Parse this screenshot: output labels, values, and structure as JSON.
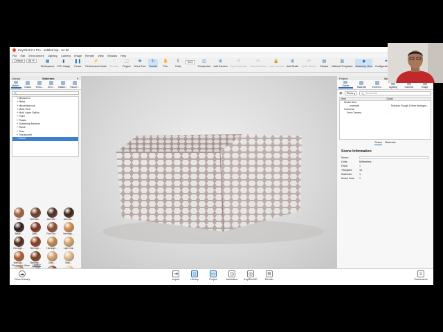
{
  "window": {
    "title": "KeyShot 8.1 Pro  -  untitled.bip  -  64 bit"
  },
  "menu": [
    "File",
    "Edit",
    "Environment",
    "Lighting",
    "Camera",
    "Image",
    "Render",
    "View",
    "Window",
    "Help"
  ],
  "toolbar": {
    "workspace_value": "Default",
    "cpu_value": "88 %",
    "fov_value": "90.0",
    "items": [
      {
        "label": "Workspaces",
        "icon": "workspaces-icon",
        "dim": false
      },
      {
        "label": "CPU Usage",
        "icon": "cpu-icon",
        "dim": false
      },
      {
        "label": "Pause",
        "icon": "pause-icon",
        "dim": false
      },
      {
        "label": "Performance Mode",
        "icon": "performance-icon",
        "dim": false
      },
      {
        "label": "Denoise",
        "icon": "denoise-icon",
        "dim": true
      },
      {
        "label": "Region",
        "icon": "region-icon",
        "dim": false
      },
      {
        "label": "Move Tool",
        "icon": "move-tool-icon",
        "dim": false
      },
      {
        "label": "Tumble",
        "icon": "tumble-icon",
        "dim": false,
        "active": true
      },
      {
        "label": "Pan",
        "icon": "pan-icon",
        "dim": false
      },
      {
        "label": "Dolly",
        "icon": "dolly-icon",
        "dim": false
      },
      {
        "label": "Perspective",
        "icon": "perspective-icon",
        "dim": false
      },
      {
        "label": "Add Camera",
        "icon": "add-camera-icon",
        "dim": false
      },
      {
        "label": "Cycle Cameras",
        "icon": "cycle-cameras-icon",
        "dim": true
      },
      {
        "label": "Reset Camera",
        "icon": "reset-camera-icon",
        "dim": true
      },
      {
        "label": "Lock Camera",
        "icon": "lock-camera-icon",
        "dim": true
      },
      {
        "label": "Add Studio",
        "icon": "add-studio-icon",
        "dim": false
      },
      {
        "label": "Cycle Studios",
        "icon": "cycle-studios-icon",
        "dim": true
      },
      {
        "label": "Studios",
        "icon": "studios-icon",
        "dim": false
      },
      {
        "label": "Material Templates",
        "icon": "material-templates-icon",
        "dim": false
      },
      {
        "label": "Geometry View",
        "icon": "geometry-view-icon",
        "dim": false,
        "active": true
      },
      {
        "label": "Configurator Wizard",
        "icon": "configurator-icon",
        "dim": false
      }
    ]
  },
  "library": {
    "title": "Library",
    "panel_title": "Materials",
    "tabs": [
      "Materi...",
      "Colors",
      "Textu...",
      "Envi...",
      "Backp...",
      "Favori..."
    ],
    "search_placeholder": "",
    "tree": [
      "Measured",
      "Metal",
      "Miscellaneous",
      "Mold-Tech",
      "Multi Layer Optics",
      "Paint",
      "Plastic",
      "Scattering Medium",
      "Stone",
      "Toon",
      "Translucent",
      "Wood"
    ],
    "selected": "Wood",
    "swatches": [
      {
        "label": "Ash",
        "color": "#a0603a"
      },
      {
        "label": "Ash Wo...",
        "color": "#6a3a22"
      },
      {
        "label": "Ash Wo...",
        "color": "#4a2a1e"
      },
      {
        "label": "Ash Wo...",
        "color": "#3a1f14"
      },
      {
        "label": "Black...",
        "color": "#2a1a14"
      },
      {
        "label": "Dark...",
        "color": "#7a2f1c"
      },
      {
        "label": "Fine Gra...",
        "color": "#8a4a2a"
      },
      {
        "label": "Herringb...",
        "color": "#d08a4a"
      },
      {
        "label": "Herringb...",
        "color": "#4a2616"
      },
      {
        "label": "Herringb...",
        "color": "#8a3a1c"
      },
      {
        "label": "Herringb...",
        "color": "#c0844a"
      },
      {
        "label": "Light Oak",
        "color": "#d6a26a"
      },
      {
        "label": "Mahoga...",
        "color": "#b05a2a"
      },
      {
        "label": "Mahoga...",
        "color": "#7a3a1c"
      },
      {
        "label": "Map...",
        "color": "#d4a070"
      },
      {
        "label": "Map...",
        "color": "#e0b890"
      },
      {
        "label": "Oak Wo...",
        "color": "#c88a50"
      },
      {
        "label": "Oak Wo...",
        "color": "#caa070"
      },
      {
        "label": "Oak Wo...",
        "color": "#8a4a24"
      },
      {
        "label": "Pine...",
        "color": "#e8c8a0"
      },
      {
        "label": "Pine...",
        "color": "#e6d2b8"
      },
      {
        "label": "Walnut",
        "color": "#6a2a1a"
      },
      {
        "label": "Wd...",
        "color": "#3a2418"
      }
    ],
    "bottom_tabs": [
      "Geometry View",
      "Library"
    ]
  },
  "project": {
    "title": "Project",
    "panel_title": "Scene",
    "tabs": [
      "Scene",
      "Material",
      "Environ...",
      "Lighting",
      "Camera",
      "Image"
    ],
    "show_label": "Show",
    "search_placeholder": "Search All",
    "columns": [
      "Item",
      "Detail"
    ],
    "rows": [
      {
        "item": "Model Sets",
        "detail": ""
      },
      {
        "item": "example",
        "detail": "Titanium Rough 10mm Hexagon..."
      },
      {
        "item": "Cameras",
        "detail": ""
      },
      {
        "item": "Free Camera",
        "detail": "-"
      }
    ],
    "subtabs": [
      "Scene",
      "Materials"
    ],
    "info_title": "Scene Information",
    "info": [
      {
        "k": "Name:",
        "v": ""
      },
      {
        "k": "Units:",
        "v": "Millimeters"
      },
      {
        "k": "Parts:",
        "v": "1"
      },
      {
        "k": "Triangles:",
        "v": "10"
      },
      {
        "k": "Materials:",
        "v": "1"
      },
      {
        "k": "Model Sets:",
        "v": "1"
      }
    ]
  },
  "bottombar": {
    "left": "Cloud Library",
    "right": "Screenshot",
    "items": [
      "Import",
      "Library",
      "Project",
      "Animation",
      "KeyShotXR",
      "Render"
    ]
  }
}
